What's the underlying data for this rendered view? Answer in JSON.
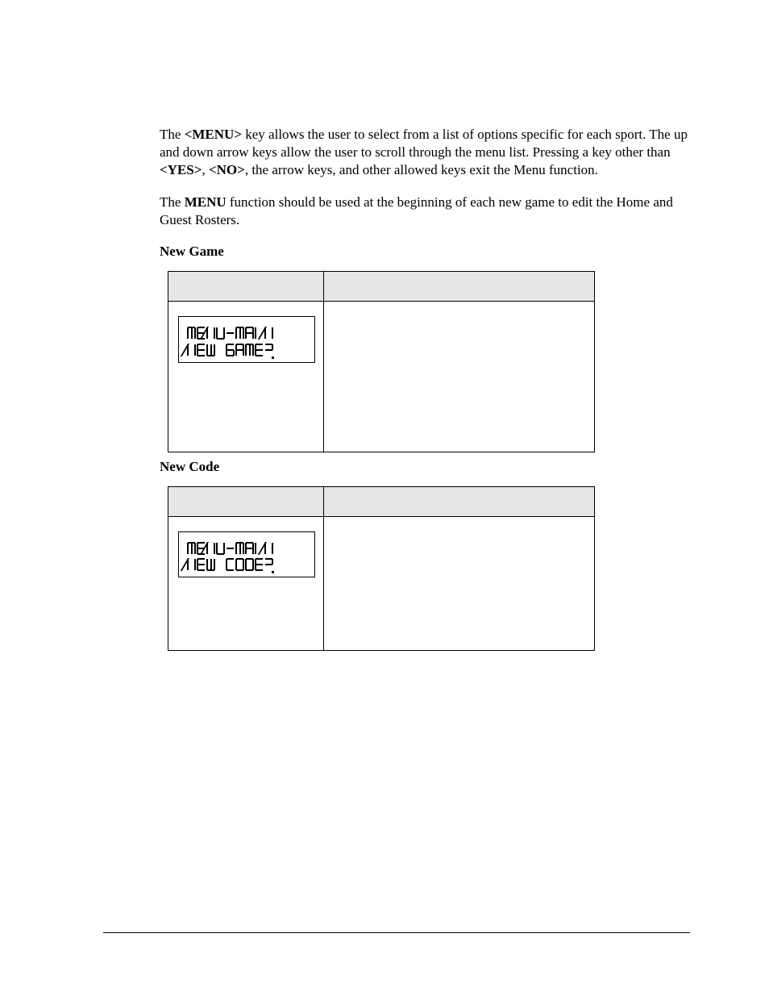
{
  "para1_pre": "The ",
  "para1_key1": "<MENU>",
  "para1_mid1": " key allows the user to select from a list of options specific for each sport. The up and down arrow keys allow the user to scroll through the menu list. Pressing a key other than ",
  "para1_key2": "<YES>",
  "para1_sep": ", ",
  "para1_key3": "<NO>",
  "para1_post": ", the arrow keys, and other allowed keys exit the Menu function.",
  "para2_pre": "The ",
  "para2_key": "MENU",
  "para2_post": " function should be used at the beginning of each new game to edit the Home and Guest Rosters.",
  "heading1": "New Game",
  "heading2": "New Code",
  "lcd1_line1": "MENU-MAIN",
  "lcd1_line2": "NEW GAME?",
  "lcd2_line1": "MENU-MAIN",
  "lcd2_line2": "NEW CODE?"
}
